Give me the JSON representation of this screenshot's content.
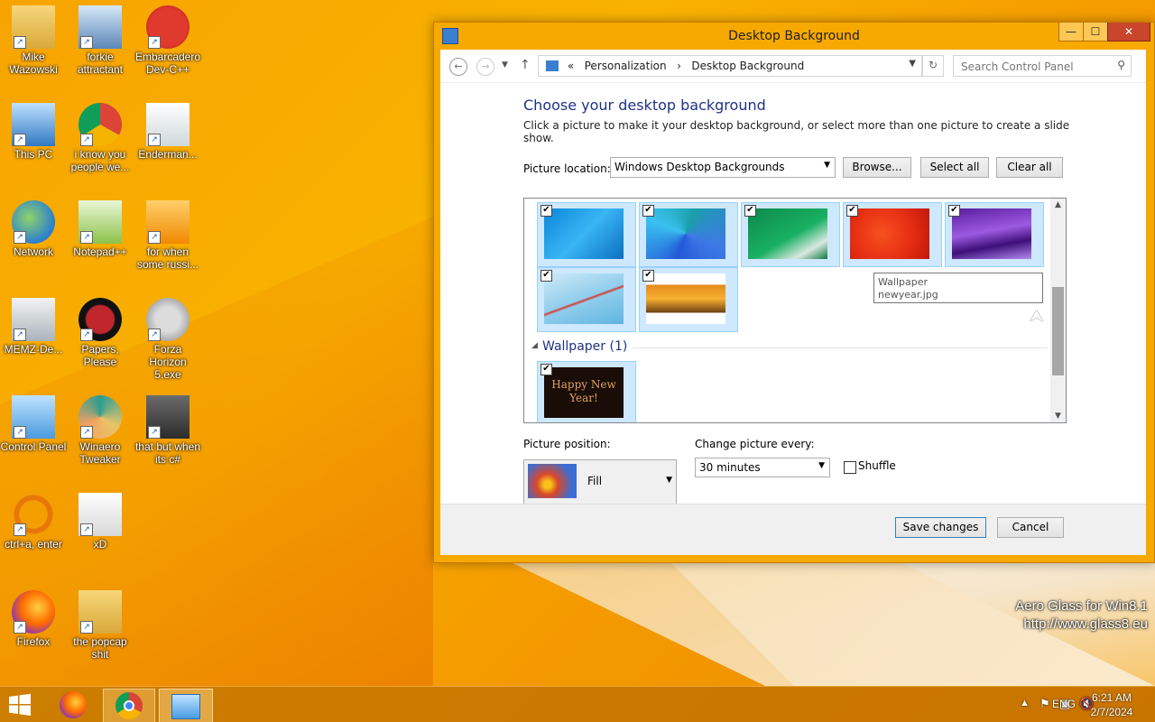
{
  "desktop": {
    "icons": [
      {
        "label": "Mike Wazowski",
        "icon": "user-folder-icon"
      },
      {
        "label": "forkie attractant",
        "icon": "pc-settings-icon"
      },
      {
        "label": "Embarcadero Dev-C++",
        "icon": "devcpp-icon"
      },
      {
        "label": "This PC",
        "icon": "computer-icon"
      },
      {
        "label": "i know you people we...",
        "icon": "chrome-icon"
      },
      {
        "label": "Enderman...",
        "icon": "document-icon"
      },
      {
        "label": "Network",
        "icon": "network-icon"
      },
      {
        "label": "Notepad++",
        "icon": "notepad-icon"
      },
      {
        "label": "for when some russi...",
        "icon": "de-icon"
      },
      {
        "label": "MEMZ-De...",
        "icon": "recycle-bin-icon"
      },
      {
        "label": "Papers, Please",
        "icon": "papers-icon"
      },
      {
        "label": "Forza Horizon 5.exe",
        "icon": "flash-icon"
      },
      {
        "label": "Control Panel",
        "icon": "control-panel-icon"
      },
      {
        "label": "Winaero Tweaker",
        "icon": "winaero-icon"
      },
      {
        "label": "that but when its c#",
        "icon": "stack-icon"
      },
      {
        "label": "ctrl+a, enter",
        "icon": "ring-icon"
      },
      {
        "label": "xD",
        "icon": "hxd-icon"
      },
      {
        "label": "Firefox",
        "icon": "firefox-icon"
      },
      {
        "label": "the popcap shit",
        "icon": "folder-icon"
      }
    ],
    "watermark_line1": "Aero Glass for Win8.1",
    "watermark_line2": "http://www.glass8.eu"
  },
  "window": {
    "title": "Desktop Background",
    "min": "—",
    "max": "☐",
    "close": "✕"
  },
  "nav": {
    "back": "←",
    "forward": "→",
    "up": "↑",
    "crumb_sep": "«",
    "crumb1": "Personalization",
    "crumb_arrow": "›",
    "crumb2": "Desktop Background",
    "refresh": "↻",
    "search_placeholder": "Search Control Panel"
  },
  "content": {
    "heading": "Choose your desktop background",
    "subtitle": "Click a picture to make it your desktop background, or select more than one picture to create a slide show.",
    "picture_location_label": "Picture location:",
    "picture_location_value": "Windows Desktop Backgrounds",
    "browse": "Browse...",
    "select_all": "Select all",
    "clear_all": "Clear all",
    "group_label": "Wallpaper (1)",
    "group_thumb_text": "Happy New Year!",
    "tooltip_line1": "Wallpaper",
    "tooltip_line2": "newyear.jpg",
    "checkmark": "✔",
    "picture_position_label": "Picture position:",
    "picture_position_value": "Fill",
    "change_every_label": "Change picture every:",
    "change_every_value": "30 minutes",
    "shuffle_label": "Shuffle",
    "save": "Save changes",
    "cancel": "Cancel"
  },
  "taskbar": {
    "language": "ENG",
    "time": "6:21 AM",
    "date": "2/7/2024"
  }
}
